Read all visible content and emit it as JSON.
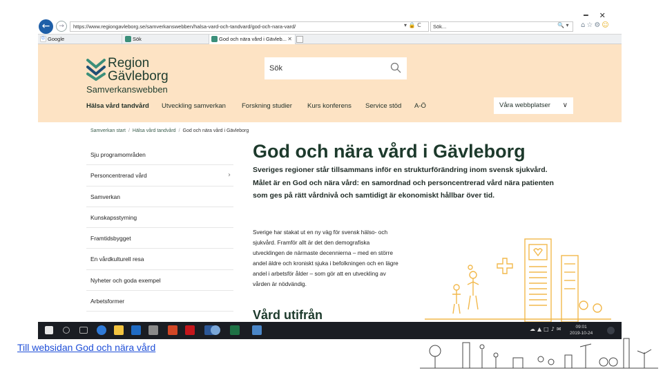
{
  "window": {
    "minimize_glyph": "━",
    "close_glyph": "✕"
  },
  "browser": {
    "url": "https://www.regiongavleborg.se/samverkanswebben/halsa-vard-och-tandvard/god-och-nara-vard/",
    "url_actions": "▾ 🔒 C",
    "search_value": "Sök...",
    "search_actions": "🔍 ▾",
    "tabs": [
      {
        "label": "Google"
      },
      {
        "label": "Sök"
      },
      {
        "label": "God och nära vård i Gävleb...",
        "close": "✕"
      }
    ]
  },
  "site": {
    "logo_line1": "Region",
    "logo_line2": "Gävleborg",
    "logo_sub": "Samverkanswebben",
    "search_placeholder": "Sök",
    "nav": [
      {
        "label": "Hälsa vård tandvård"
      },
      {
        "label": "Utveckling samverkan"
      },
      {
        "label": "Forskning studier"
      },
      {
        "label": "Kurs konferens"
      },
      {
        "label": "Service stöd"
      },
      {
        "label": "A-Ö"
      }
    ],
    "webbplatser_label": "Våra webbplatser",
    "breadcrumb": [
      "Samverkan start",
      "Hälsa vård tandvård",
      "God och nära vård i Gävleborg"
    ],
    "sidemenu": [
      {
        "label": "Sju programområden"
      },
      {
        "label": "Personcentrerad vård",
        "chevron": "›"
      },
      {
        "label": "Samverkan"
      },
      {
        "label": "Kunskapsstyrning"
      },
      {
        "label": "Framtidsbygget"
      },
      {
        "label": "En vårdkulturell resa"
      },
      {
        "label": "Nyheter och goda exempel"
      },
      {
        "label": "Arbetsformer"
      }
    ],
    "title": "God och nära vård i Gävleborg",
    "lead": "Sveriges regioner står tillsammans inför en strukturförändring inom svensk sjukvård. Målet är en God och nära vård: en samordnad och personcentrerad vård nära patienten som ges på rätt vårdnivå och samtidigt är ekonomiskt hållbar över tid.",
    "body": "Sverige har stakat ut en ny väg för svensk hälso- och sjukvård. Framför allt är det den demografiska utvecklingen de närmaste decennierna – med en större andel äldre och kroniskt sjuka i befolkningen och en lägre andel i arbetsför ålder – som gör att en utveckling av vården är nödvändig.",
    "subheading": "Vård utifrån"
  },
  "taskbar": {
    "time": "09:01",
    "date": "2019-10-24"
  },
  "slide": {
    "link_text": "Till websidan God och nära vård"
  },
  "colors": {
    "header_bg": "#fde3c4",
    "brand_green": "#1f3d2f",
    "logo_teal": "#3b8f7a",
    "taskbar": "#1a1d23",
    "link": "#1f4fd8",
    "illustration_orange": "#f2b84b"
  }
}
